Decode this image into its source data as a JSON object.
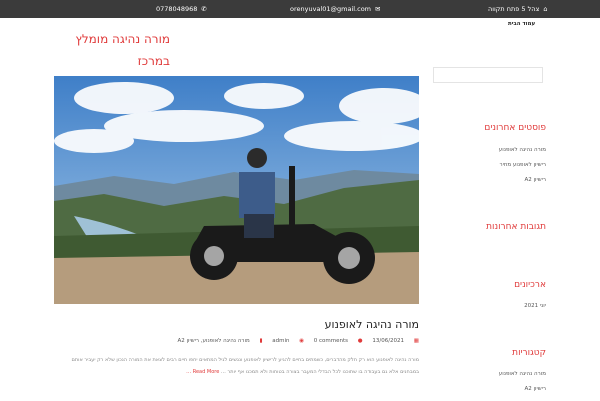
{
  "topbar": {
    "address": "צהל 5 פתח תקווה",
    "email": "orenyuval01@gmail.com",
    "phone": "0778048968"
  },
  "menu": {
    "home": "עמוד הבית"
  },
  "site": {
    "title": "מורה נהיגה מומלץ במרכז"
  },
  "post": {
    "title": "מורה נהיגה לאופנוע",
    "date": "13/06/2021",
    "comments": "0 comments",
    "author": "admin",
    "categories": "מורה נהיגה לאופנוע, רישיון A2",
    "excerpt": "מורה נהיגה לאופנוע הוא רק חלק מהדברים, כשמתים בחיים להגיע לרישיון לאופנוע ונגשים לגיל המתאים יחפו חיים רבים לצאת את המורה הנכון שלא רק יעביר אותם במבחנים אלא גם בעבודה בו שתוכנו לכל הבדלי המעבר בצורה בטוחות ולא תמכנו אף יותר … ",
    "read_more": "Read More …"
  },
  "sidebar": {
    "recent_posts": {
      "title": "פוסטים אחרונים",
      "items": [
        "מורה נהיגה לאופנוע",
        "רישיון לאופנוע מחיר",
        "רישיון A2"
      ]
    },
    "recent_comments": {
      "title": "תגובות אחרונות"
    },
    "archives": {
      "title": "ארכיונים",
      "items": [
        "יוני 2021"
      ]
    },
    "categories": {
      "title": "קטגוריות",
      "items": [
        "מורה נהיגה לאופנוע",
        "רישיון A2"
      ]
    }
  },
  "icons": {
    "home": "home-icon",
    "email": "envelope-icon",
    "phone": "phone-icon",
    "calendar": "calendar-icon",
    "user": "user-icon",
    "comment": "comment-icon",
    "folder": "folder-icon"
  },
  "colors": {
    "accent": "#e03b3b",
    "topbar": "#3b3b3b"
  }
}
